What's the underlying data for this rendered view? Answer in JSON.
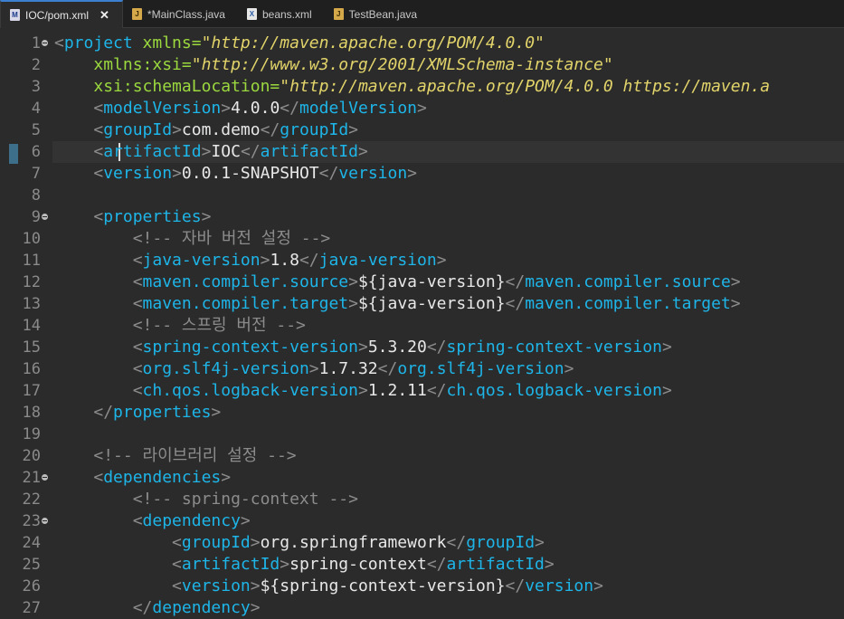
{
  "tabs": [
    {
      "label": "IOC/pom.xml",
      "icon": "maven-file-icon",
      "active": true,
      "closable": true
    },
    {
      "label": "*MainClass.java",
      "icon": "java-file-icon",
      "active": false,
      "closable": false
    },
    {
      "label": "beans.xml",
      "icon": "xml-file-icon",
      "active": false,
      "closable": false
    },
    {
      "label": "TestBean.java",
      "icon": "java-file-icon",
      "active": false,
      "closable": false
    }
  ],
  "editor": {
    "current_line": 6,
    "lines": [
      {
        "n": "1",
        "fold": true,
        "segs": [
          [
            "p",
            "<"
          ],
          [
            "t",
            "project"
          ],
          [
            "x",
            " "
          ],
          [
            "a",
            "xmlns="
          ],
          [
            "s",
            "\"http://maven.apache.org/POM/4.0.0\""
          ]
        ]
      },
      {
        "n": "2",
        "segs": [
          [
            "x",
            "    "
          ],
          [
            "a",
            "xmlns:xsi="
          ],
          [
            "s",
            "\"http://www.w3.org/2001/XMLSchema-instance\""
          ]
        ]
      },
      {
        "n": "3",
        "segs": [
          [
            "x",
            "    "
          ],
          [
            "a",
            "xsi:schemaLocation="
          ],
          [
            "s",
            "\"http://maven.apache.org/POM/4.0.0 https://maven.a"
          ]
        ]
      },
      {
        "n": "4",
        "segs": [
          [
            "x",
            "    "
          ],
          [
            "p",
            "<"
          ],
          [
            "t",
            "modelVersion"
          ],
          [
            "p",
            ">"
          ],
          [
            "x",
            "4.0.0"
          ],
          [
            "p",
            "</"
          ],
          [
            "t",
            "modelVersion"
          ],
          [
            "p",
            ">"
          ]
        ]
      },
      {
        "n": "5",
        "segs": [
          [
            "x",
            "    "
          ],
          [
            "p",
            "<"
          ],
          [
            "t",
            "groupId"
          ],
          [
            "p",
            ">"
          ],
          [
            "x",
            "com.demo"
          ],
          [
            "p",
            "</"
          ],
          [
            "t",
            "groupId"
          ],
          [
            "p",
            ">"
          ]
        ]
      },
      {
        "n": "6",
        "segs": [
          [
            "x",
            "    "
          ],
          [
            "p",
            "<"
          ],
          [
            "t",
            "artifactId"
          ],
          [
            "p",
            ">"
          ],
          [
            "x",
            "IOC"
          ],
          [
            "p",
            "</"
          ],
          [
            "t",
            "artifactId"
          ],
          [
            "p",
            ">"
          ]
        ]
      },
      {
        "n": "7",
        "segs": [
          [
            "x",
            "    "
          ],
          [
            "p",
            "<"
          ],
          [
            "t",
            "version"
          ],
          [
            "p",
            ">"
          ],
          [
            "x",
            "0.0.1-SNAPSHOT"
          ],
          [
            "p",
            "</"
          ],
          [
            "t",
            "version"
          ],
          [
            "p",
            ">"
          ]
        ]
      },
      {
        "n": "8",
        "segs": []
      },
      {
        "n": "9",
        "fold": true,
        "segs": [
          [
            "x",
            "    "
          ],
          [
            "p",
            "<"
          ],
          [
            "t",
            "properties"
          ],
          [
            "p",
            ">"
          ]
        ]
      },
      {
        "n": "10",
        "segs": [
          [
            "x",
            "        "
          ],
          [
            "c",
            "<!-- 자바 버전 설정 -->"
          ]
        ]
      },
      {
        "n": "11",
        "segs": [
          [
            "x",
            "        "
          ],
          [
            "p",
            "<"
          ],
          [
            "t",
            "java-version"
          ],
          [
            "p",
            ">"
          ],
          [
            "x",
            "1.8"
          ],
          [
            "p",
            "</"
          ],
          [
            "t",
            "java-version"
          ],
          [
            "p",
            ">"
          ]
        ]
      },
      {
        "n": "12",
        "segs": [
          [
            "x",
            "        "
          ],
          [
            "p",
            "<"
          ],
          [
            "t",
            "maven.compiler.source"
          ],
          [
            "p",
            ">"
          ],
          [
            "x",
            "${java-version}"
          ],
          [
            "p",
            "</"
          ],
          [
            "t",
            "maven.compiler.source"
          ],
          [
            "p",
            ">"
          ]
        ]
      },
      {
        "n": "13",
        "segs": [
          [
            "x",
            "        "
          ],
          [
            "p",
            "<"
          ],
          [
            "t",
            "maven.compiler.target"
          ],
          [
            "p",
            ">"
          ],
          [
            "x",
            "${java-version}"
          ],
          [
            "p",
            "</"
          ],
          [
            "t",
            "maven.compiler.target"
          ],
          [
            "p",
            ">"
          ]
        ]
      },
      {
        "n": "14",
        "segs": [
          [
            "x",
            "        "
          ],
          [
            "c",
            "<!-- 스프링 버전 -->"
          ]
        ]
      },
      {
        "n": "15",
        "segs": [
          [
            "x",
            "        "
          ],
          [
            "p",
            "<"
          ],
          [
            "t",
            "spring-context-version"
          ],
          [
            "p",
            ">"
          ],
          [
            "x",
            "5.3.20"
          ],
          [
            "p",
            "</"
          ],
          [
            "t",
            "spring-context-version"
          ],
          [
            "p",
            ">"
          ]
        ]
      },
      {
        "n": "16",
        "segs": [
          [
            "x",
            "        "
          ],
          [
            "p",
            "<"
          ],
          [
            "t",
            "org.slf4j-version"
          ],
          [
            "p",
            ">"
          ],
          [
            "x",
            "1.7.32"
          ],
          [
            "p",
            "</"
          ],
          [
            "t",
            "org.slf4j-version"
          ],
          [
            "p",
            ">"
          ]
        ]
      },
      {
        "n": "17",
        "segs": [
          [
            "x",
            "        "
          ],
          [
            "p",
            "<"
          ],
          [
            "t",
            "ch.qos.logback-version"
          ],
          [
            "p",
            ">"
          ],
          [
            "x",
            "1.2.11"
          ],
          [
            "p",
            "</"
          ],
          [
            "t",
            "ch.qos.logback-version"
          ],
          [
            "p",
            ">"
          ]
        ]
      },
      {
        "n": "18",
        "segs": [
          [
            "x",
            "    "
          ],
          [
            "p",
            "</"
          ],
          [
            "t",
            "properties"
          ],
          [
            "p",
            ">"
          ]
        ]
      },
      {
        "n": "19",
        "segs": []
      },
      {
        "n": "20",
        "segs": [
          [
            "x",
            "    "
          ],
          [
            "c",
            "<!-- 라이브러리 설정 -->"
          ]
        ]
      },
      {
        "n": "21",
        "fold": true,
        "segs": [
          [
            "x",
            "    "
          ],
          [
            "p",
            "<"
          ],
          [
            "t",
            "dependencies"
          ],
          [
            "p",
            ">"
          ]
        ]
      },
      {
        "n": "22",
        "segs": [
          [
            "x",
            "        "
          ],
          [
            "c",
            "<!-- spring-context -->"
          ]
        ]
      },
      {
        "n": "23",
        "fold": true,
        "segs": [
          [
            "x",
            "        "
          ],
          [
            "p",
            "<"
          ],
          [
            "t",
            "dependency"
          ],
          [
            "p",
            ">"
          ]
        ]
      },
      {
        "n": "24",
        "segs": [
          [
            "x",
            "            "
          ],
          [
            "p",
            "<"
          ],
          [
            "t",
            "groupId"
          ],
          [
            "p",
            ">"
          ],
          [
            "x",
            "org.springframework"
          ],
          [
            "p",
            "</"
          ],
          [
            "t",
            "groupId"
          ],
          [
            "p",
            ">"
          ]
        ]
      },
      {
        "n": "25",
        "segs": [
          [
            "x",
            "            "
          ],
          [
            "p",
            "<"
          ],
          [
            "t",
            "artifactId"
          ],
          [
            "p",
            ">"
          ],
          [
            "x",
            "spring-context"
          ],
          [
            "p",
            "</"
          ],
          [
            "t",
            "artifactId"
          ],
          [
            "p",
            ">"
          ]
        ]
      },
      {
        "n": "26",
        "segs": [
          [
            "x",
            "            "
          ],
          [
            "p",
            "<"
          ],
          [
            "t",
            "version"
          ],
          [
            "p",
            ">"
          ],
          [
            "x",
            "${spring-context-version}"
          ],
          [
            "p",
            "</"
          ],
          [
            "t",
            "version"
          ],
          [
            "p",
            ">"
          ]
        ]
      },
      {
        "n": "27",
        "segs": [
          [
            "x",
            "        "
          ],
          [
            "p",
            "</"
          ],
          [
            "t",
            "dependency"
          ],
          [
            "p",
            ">"
          ]
        ]
      }
    ]
  }
}
